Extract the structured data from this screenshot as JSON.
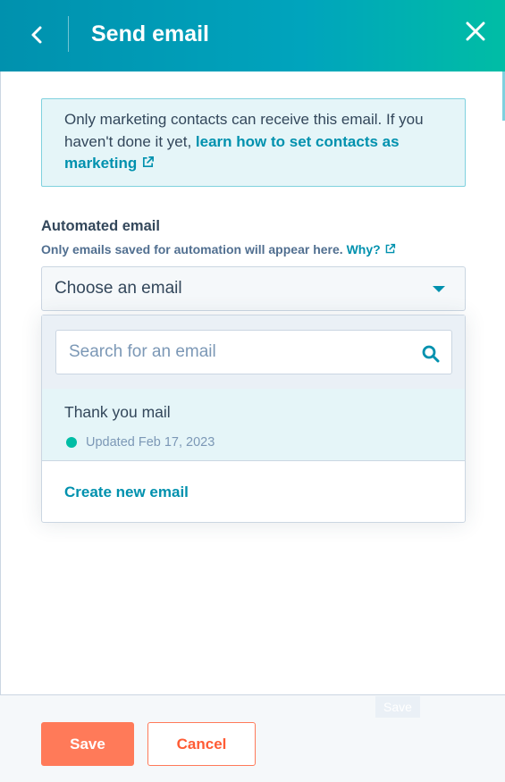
{
  "header": {
    "title": "Send email",
    "back_icon": "chevron-left-icon",
    "close_icon": "close-icon"
  },
  "notice": {
    "text": "Only marketing contacts can receive this email. If you haven't done it yet, ",
    "link_text": "learn how to set contacts as marketing",
    "link_icon": "external-link-icon"
  },
  "automated_email": {
    "label": "Automated email",
    "help_text": "Only emails saved for automation will appear here. ",
    "help_link": "Why?",
    "select_value": "Choose an email"
  },
  "dropdown": {
    "search_placeholder": "Search for an email",
    "options": [
      {
        "name": "Thank you mail",
        "meta": "Updated Feb 17, 2023",
        "status_color": "#00bda5"
      }
    ],
    "create_label": "Create new email"
  },
  "footer": {
    "ghost_label": "Save",
    "save_label": "Save",
    "cancel_label": "Cancel"
  },
  "colors": {
    "header_gradient_start": "#0091ae",
    "header_gradient_end": "#00bda5",
    "link": "#0091ae",
    "primary_button": "#ff7a59"
  }
}
